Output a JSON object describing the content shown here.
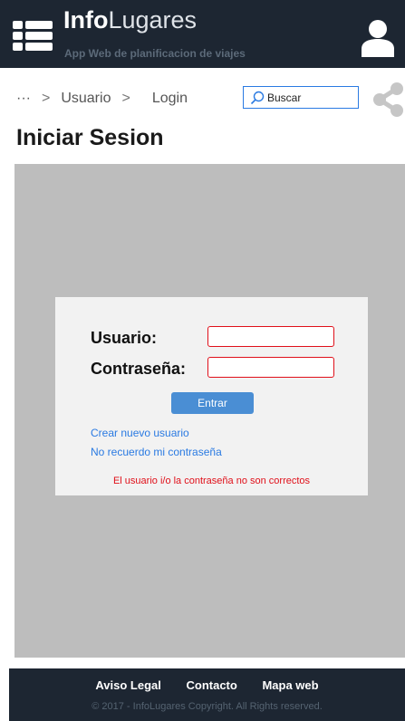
{
  "header": {
    "brand_bold": "Info",
    "brand_rest": "Lugares",
    "tagline": "App Web de planificacion de viajes"
  },
  "breadcrumb": {
    "ellipsis": "···",
    "sep": ">",
    "item1": "Usuario",
    "item2": "Login"
  },
  "search": {
    "placeholder": "Buscar"
  },
  "page": {
    "title": "Iniciar Sesion"
  },
  "login": {
    "user_label": "Usuario:",
    "pass_label": "Contraseña:",
    "user_value": "",
    "pass_value": "",
    "submit_label": "Entrar",
    "create_link": "Crear nuevo usuario",
    "forgot_link": "No recuerdo mi contraseña",
    "error": "El usuario i/o la contraseña no son correctos"
  },
  "footer": {
    "legal": "Aviso Legal",
    "contact": "Contacto",
    "sitemap": "Mapa web",
    "copyright": "© 2017 - InfoLugares Copyright. All Rights reserved."
  },
  "icons": {
    "menu": "menu-list-icon",
    "user": "user-icon",
    "search": "search-icon",
    "share": "share-icon"
  },
  "colors": {
    "header_bg": "#1d2632",
    "accent": "#2a7ae2",
    "button": "#4a8ed4",
    "error": "#e0101a",
    "content_bg": "#bdbdbd",
    "card_bg": "#f2f2f2"
  }
}
